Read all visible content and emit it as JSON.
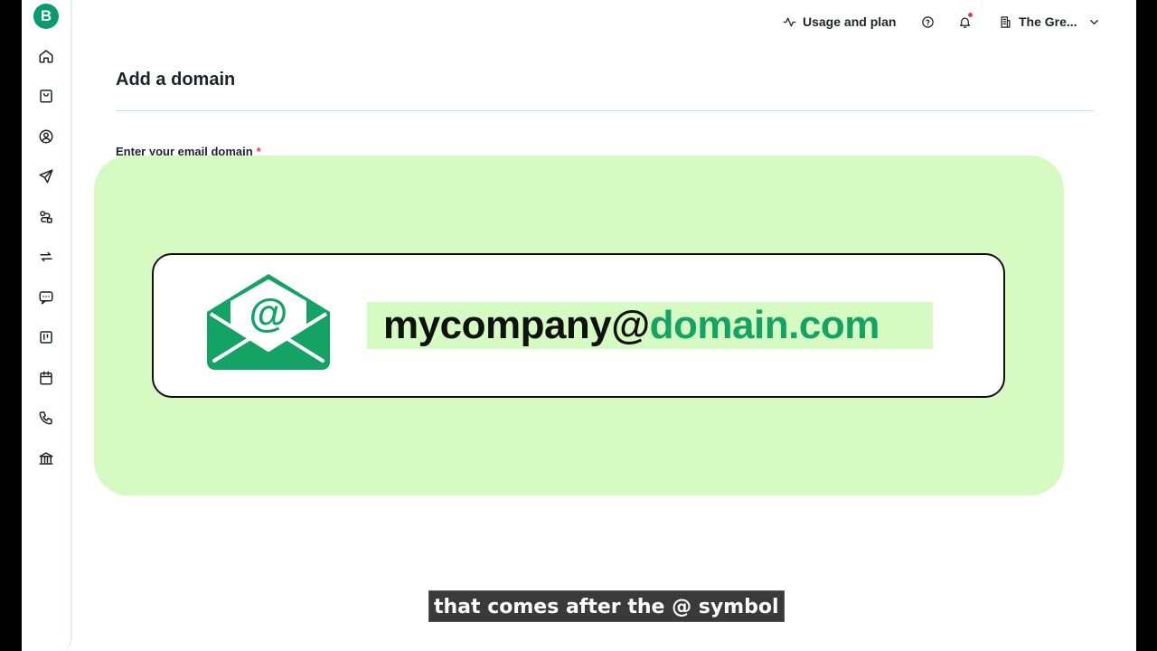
{
  "app": {
    "logo_letter": "B"
  },
  "sidebar": {
    "items": [
      {
        "name": "home-icon"
      },
      {
        "name": "shopping-bag-icon"
      },
      {
        "name": "contacts-icon"
      },
      {
        "name": "send-icon"
      },
      {
        "name": "automation-icon"
      },
      {
        "name": "sync-icon"
      },
      {
        "name": "chat-icon"
      },
      {
        "name": "board-icon"
      },
      {
        "name": "calendar-icon"
      },
      {
        "name": "phone-icon"
      },
      {
        "name": "bank-icon"
      }
    ]
  },
  "topbar": {
    "usage_label": "Usage and plan",
    "account_name": "The Gre..."
  },
  "main": {
    "title": "Add a domain",
    "field_label": "Enter your email domain",
    "required_mark": "*"
  },
  "overlay": {
    "email_local": "mycompany@",
    "email_domain": "domain.com",
    "envelope_symbol": "@",
    "colors": {
      "background": "#d6fbc2",
      "envelope": "#14a364",
      "domain_text": "#14a364"
    }
  },
  "caption": {
    "text": "that comes after the @ symbol"
  }
}
